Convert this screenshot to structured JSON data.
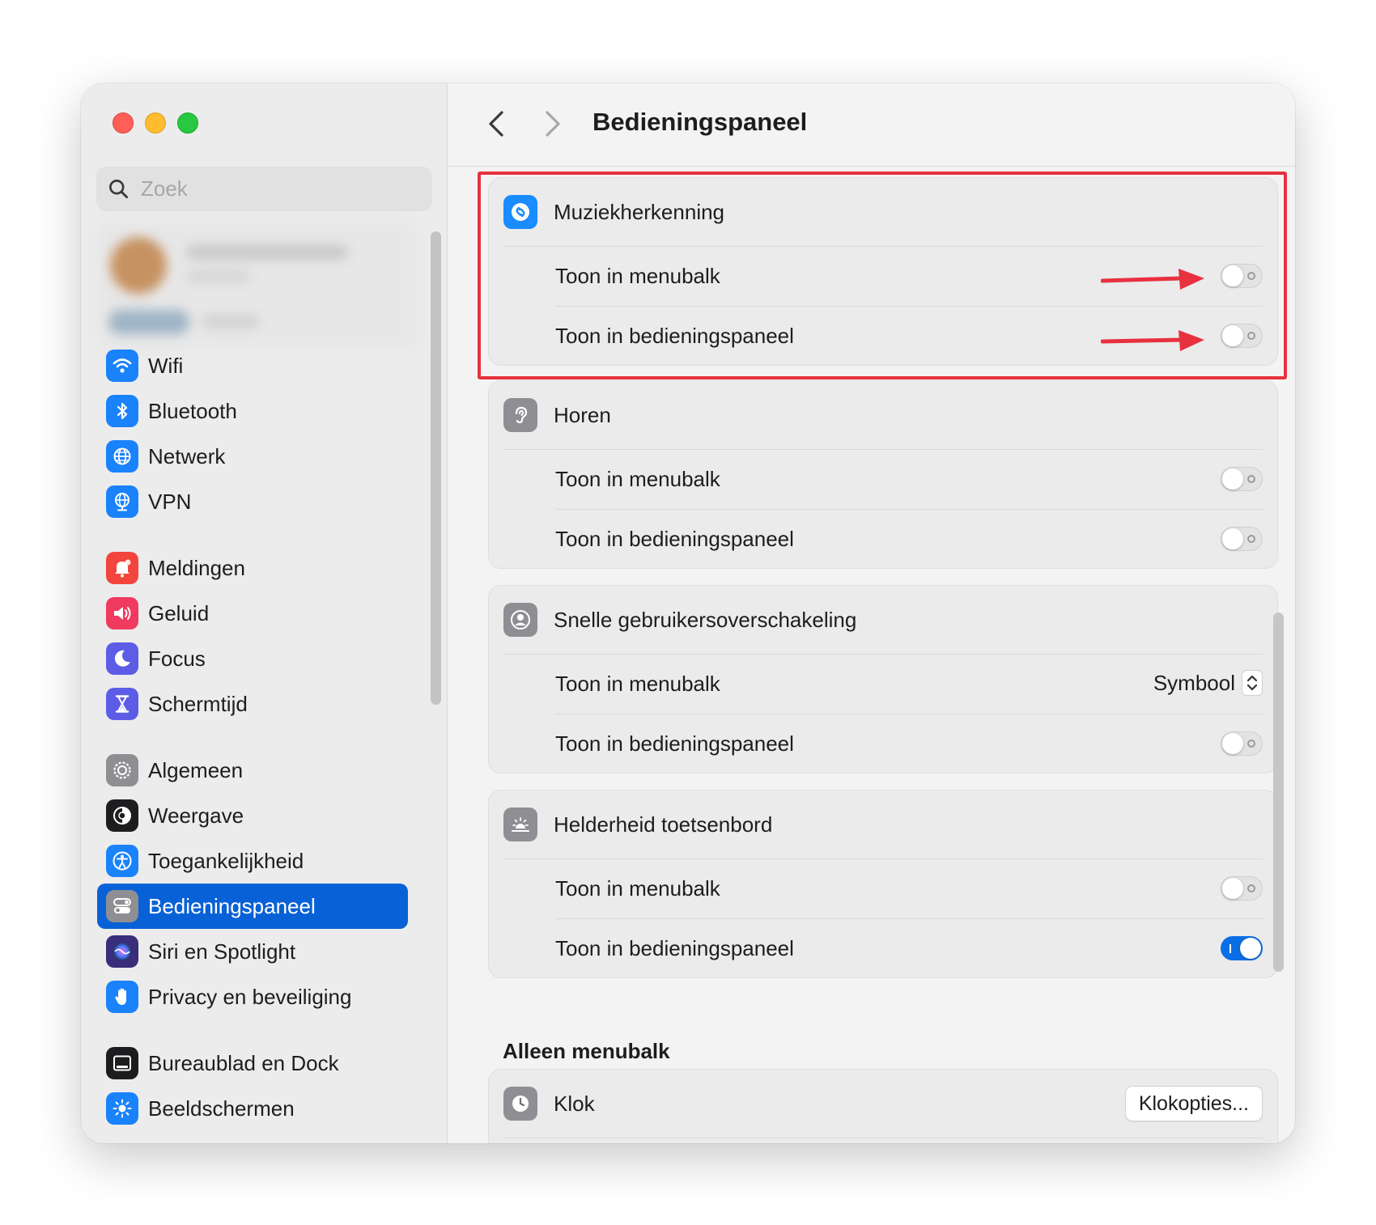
{
  "search": {
    "placeholder": "Zoek"
  },
  "sidebar": {
    "groups": [
      [
        {
          "label": "Wifi",
          "icon": "wifi-icon",
          "color": "#1a82fb"
        },
        {
          "label": "Bluetooth",
          "icon": "bluetooth-icon",
          "color": "#1a82fb"
        },
        {
          "label": "Netwerk",
          "icon": "globe-icon",
          "color": "#1a82fb"
        },
        {
          "label": "VPN",
          "icon": "vpn-globe-icon",
          "color": "#1a82fb"
        }
      ],
      [
        {
          "label": "Meldingen",
          "icon": "bell-icon",
          "color": "#f2453d"
        },
        {
          "label": "Geluid",
          "icon": "speaker-icon",
          "color": "#f03a5f"
        },
        {
          "label": "Focus",
          "icon": "moon-icon",
          "color": "#5d5ce6"
        },
        {
          "label": "Schermtijd",
          "icon": "hourglass-icon",
          "color": "#5d5ce6"
        }
      ],
      [
        {
          "label": "Algemeen",
          "icon": "gear-icon",
          "color": "#8e8e93"
        },
        {
          "label": "Weergave",
          "icon": "appearance-icon",
          "color": "#1d1d1f"
        },
        {
          "label": "Toegankelijkheid",
          "icon": "accessibility-icon",
          "color": "#1a82fb"
        },
        {
          "label": "Bedieningspaneel",
          "icon": "control-center-icon",
          "color": "#8e8e93",
          "active": true
        },
        {
          "label": "Siri en Spotlight",
          "icon": "siri-icon",
          "color": "#3a2d7a"
        },
        {
          "label": "Privacy en beveiliging",
          "icon": "hand-icon",
          "color": "#1a82fb"
        }
      ],
      [
        {
          "label": "Bureaublad en Dock",
          "icon": "dock-icon",
          "color": "#1d1d1f"
        },
        {
          "label": "Beeldschermen",
          "icon": "sun-icon",
          "color": "#1a82fb"
        }
      ]
    ]
  },
  "toolbar": {
    "title": "Bedieningspaneel"
  },
  "panels": [
    {
      "title": "Muziekherkenning",
      "icon": "shazam-icon",
      "rows": [
        {
          "label": "Toon in menubalk",
          "control": "toggle",
          "on": false
        },
        {
          "label": "Toon in bedieningspaneel",
          "control": "toggle",
          "on": false
        }
      ]
    },
    {
      "title": "Horen",
      "icon": "ear-icon",
      "rows": [
        {
          "label": "Toon in menubalk",
          "control": "toggle",
          "on": false
        },
        {
          "label": "Toon in bedieningspaneel",
          "control": "toggle",
          "on": false
        }
      ]
    },
    {
      "title": "Snelle gebruikersoverschakeling",
      "icon": "user-icon",
      "rows": [
        {
          "label": "Toon in menubalk",
          "control": "select",
          "value": "Symbool"
        },
        {
          "label": "Toon in bedieningspaneel",
          "control": "toggle",
          "on": false
        }
      ]
    },
    {
      "title": "Helderheid toetsenbord",
      "icon": "keyboard-brightness-icon",
      "rows": [
        {
          "label": "Toon in menubalk",
          "control": "toggle",
          "on": false
        },
        {
          "label": "Toon in bedieningspaneel",
          "control": "toggle",
          "on": true
        }
      ]
    }
  ],
  "menubar_only": {
    "title": "Alleen menubalk",
    "clock": {
      "label": "Klok",
      "icon": "clock-icon",
      "button": "Klokopties..."
    }
  },
  "colors": {
    "accent": "#0861d6",
    "annotation": "#e8313f"
  }
}
